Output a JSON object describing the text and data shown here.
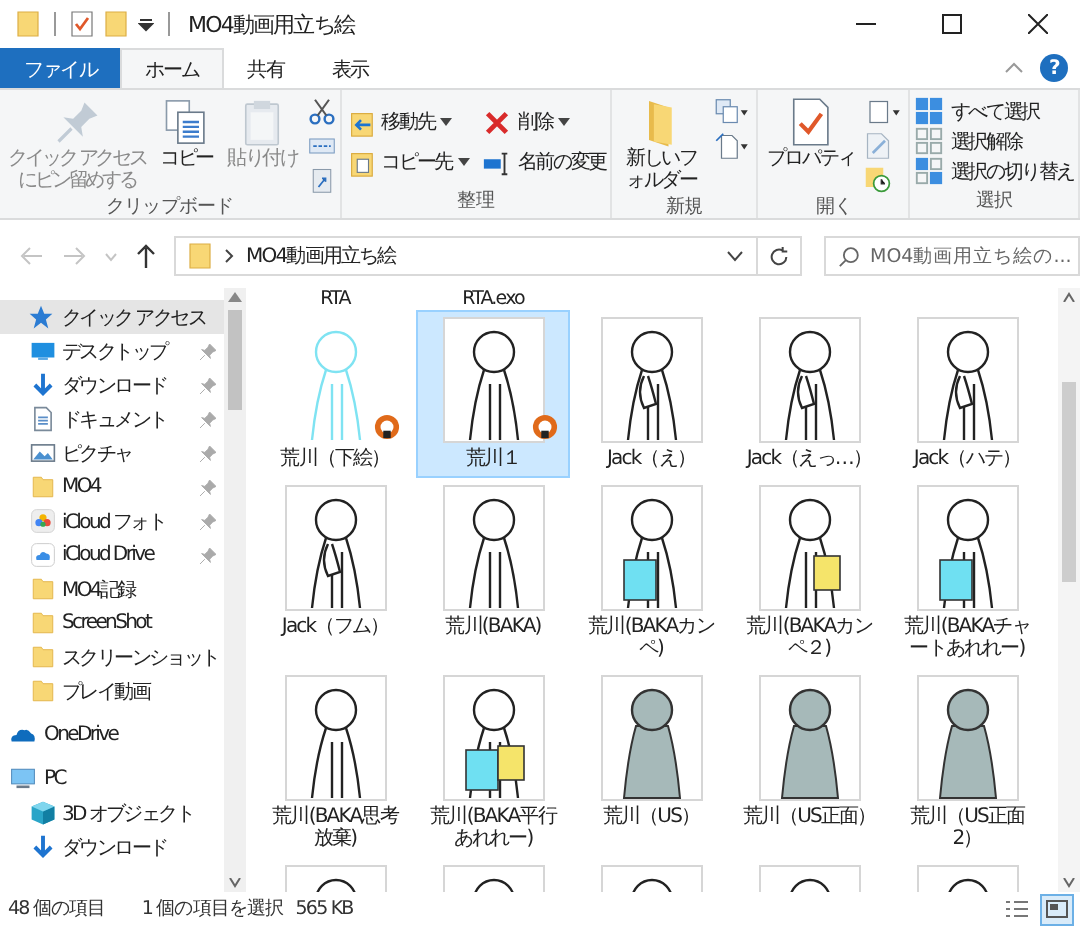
{
  "window": {
    "title": "MO4動画用立ち絵"
  },
  "ribbon_tabs": [
    {
      "label": "ファイル",
      "kind": "file",
      "selected": false
    },
    {
      "label": "ホーム",
      "kind": "tab",
      "selected": true
    },
    {
      "label": "共有",
      "kind": "tab",
      "selected": false
    },
    {
      "label": "表示",
      "kind": "tab",
      "selected": false
    }
  ],
  "help": "?",
  "ribbon": {
    "groups": [
      {
        "label": "クリップボード",
        "buttons": [
          {
            "kind": "large",
            "label": "クイック アクセスにピン留めする",
            "disabled": true
          },
          {
            "kind": "large",
            "label": "コピー",
            "disabled": false
          },
          {
            "kind": "large",
            "label": "貼り付け",
            "disabled": true
          }
        ]
      },
      {
        "label": "整理",
        "buttons": [
          {
            "kind": "small",
            "label": "移動先",
            "dropdown": true
          },
          {
            "kind": "small",
            "label": "コピー先",
            "dropdown": true
          },
          {
            "kind": "small",
            "label": "削除",
            "dropdown": true
          },
          {
            "kind": "small",
            "label": "名前の変更",
            "dropdown": false
          }
        ]
      },
      {
        "label": "新規",
        "buttons": [
          {
            "kind": "large",
            "label": "新しいフォルダー",
            "disabled": false
          }
        ]
      },
      {
        "label": "開く",
        "buttons": [
          {
            "kind": "large",
            "label": "プロパティ",
            "disabled": false
          }
        ]
      },
      {
        "label": "選択",
        "buttons": [
          {
            "kind": "small",
            "label": "すべて選択",
            "dropdown": false
          },
          {
            "kind": "small",
            "label": "選択解除",
            "dropdown": false
          },
          {
            "kind": "small",
            "label": "選択の切り替え",
            "dropdown": false
          }
        ]
      }
    ]
  },
  "address": {
    "path": "MO4動画用立ち絵"
  },
  "search": {
    "placeholder": "MO4動画用立ち絵の..."
  },
  "sidebar": {
    "items": [
      {
        "label": "クイック アクセス",
        "kind": "quick",
        "selected": true,
        "children": [
          {
            "label": "デスクトップ",
            "kind": "desktop",
            "pinned": true
          },
          {
            "label": "ダウンロード",
            "kind": "downloads",
            "pinned": true
          },
          {
            "label": "ドキュメント",
            "kind": "documents",
            "pinned": true
          },
          {
            "label": "ピクチャ",
            "kind": "pictures",
            "pinned": true
          },
          {
            "label": "MO4",
            "kind": "folder",
            "pinned": true
          },
          {
            "label": "iCloud フォト",
            "kind": "photos",
            "pinned": true
          },
          {
            "label": "iCloud Drive",
            "kind": "cloud",
            "pinned": true
          },
          {
            "label": "MO4記録",
            "kind": "folder",
            "pinned": false
          },
          {
            "label": "ScreenShot",
            "kind": "folder",
            "pinned": false
          },
          {
            "label": "スクリーンショット",
            "kind": "folder",
            "pinned": false
          },
          {
            "label": "プレイ動画",
            "kind": "folder",
            "pinned": false
          }
        ]
      },
      {
        "label": "OneDrive",
        "kind": "onedrive",
        "selected": false
      },
      {
        "label": "PC",
        "kind": "pc",
        "selected": false,
        "children": [
          {
            "label": "3D オブジェクト",
            "kind": "objects3d",
            "pinned": false
          },
          {
            "label": "ダウンロード",
            "kind": "downloads",
            "pinned": false
          }
        ]
      }
    ]
  },
  "content": {
    "labels_above": [
      "RTA",
      "RTA.exo"
    ],
    "items": [
      {
        "label": "荒川（下絵）",
        "selected": false,
        "badge": true
      },
      {
        "label": "荒川１",
        "selected": true,
        "badge": true
      },
      {
        "label": "Jack（え）",
        "selected": false,
        "badge": false
      },
      {
        "label": "Jack（えっ…）",
        "selected": false,
        "badge": false
      },
      {
        "label": "Jack（ハテ）",
        "selected": false,
        "badge": false
      },
      {
        "label": "Jack（フム）",
        "selected": false,
        "badge": false
      },
      {
        "label": "荒川(BAKA)",
        "selected": false,
        "badge": false
      },
      {
        "label": "荒川(BAKAカンペ)",
        "selected": false,
        "badge": false
      },
      {
        "label": "荒川(BAKAカンペ２)",
        "selected": false,
        "badge": false
      },
      {
        "label": "荒川(BAKAチャートあれれー)",
        "selected": false,
        "badge": false
      },
      {
        "label": "荒川(BAKA思考放棄)",
        "selected": false,
        "badge": false
      },
      {
        "label": "荒川(BAKA平行あれれー)",
        "selected": false,
        "badge": false
      },
      {
        "label": "荒川（US）",
        "selected": false,
        "badge": false
      },
      {
        "label": "荒川（US正面）",
        "selected": false,
        "badge": false
      },
      {
        "label": "荒川（US正面2）",
        "selected": false,
        "badge": false
      }
    ],
    "cut_off_items": [
      {
        "kind": "picture"
      },
      {
        "kind": "picture"
      },
      {
        "kind": "picture"
      },
      {
        "kind": "picture"
      },
      {
        "kind": "picture"
      }
    ]
  },
  "status_bar": {
    "count": "48 個の項目",
    "selection": "1 個の項目を選択",
    "size": "565 KB",
    "views": [
      {
        "kind": "details",
        "selected": false
      },
      {
        "kind": "large_icons",
        "selected": true
      }
    ]
  }
}
